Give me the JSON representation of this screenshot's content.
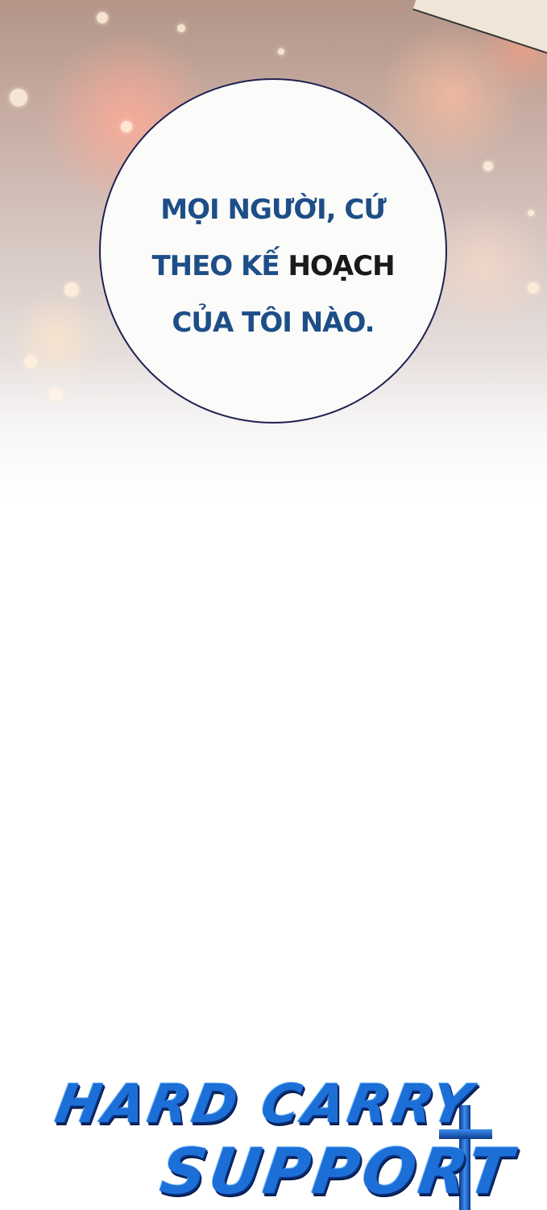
{
  "speech_bubble": {
    "line1": "MỌI NGƯỜI, CỨ",
    "line2_part1": "THEO KẾ ",
    "line2_part2": "HOẠCH",
    "line3": "CỦA TÔI NÀO."
  },
  "logo": {
    "line1": "HARD CARRY",
    "line2": "SUPPORT"
  },
  "colors": {
    "text_blue": "#1d4e87",
    "logo_blue": "#1d6fd8",
    "bubble_border": "#1f2150"
  }
}
